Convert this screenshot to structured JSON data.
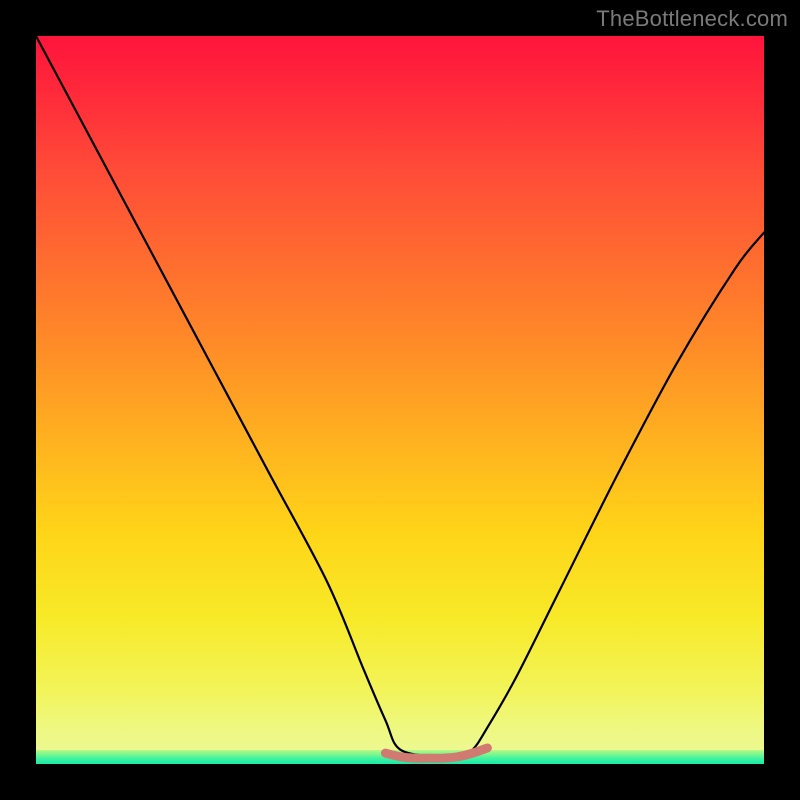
{
  "watermark": "TheBottleneck.com",
  "chart_data": {
    "type": "line",
    "title": "",
    "xlabel": "",
    "ylabel": "",
    "xlim": [
      0,
      100
    ],
    "ylim": [
      0,
      100
    ],
    "grid": false,
    "series": [
      {
        "name": "bottleneck-curve",
        "x": [
          0,
          8,
          16,
          24,
          32,
          40,
          45,
          48,
          50,
          55,
          58,
          60,
          62,
          66,
          72,
          80,
          88,
          96,
          100
        ],
        "values": [
          100,
          85,
          70,
          55,
          40,
          25,
          13,
          6,
          2,
          1,
          1,
          2,
          5,
          12,
          24,
          40,
          55,
          68,
          73
        ]
      },
      {
        "name": "trough-marker",
        "x": [
          48,
          50,
          52,
          54,
          56,
          58,
          60,
          62
        ],
        "values": [
          1.5,
          1.0,
          0.8,
          0.8,
          0.8,
          1.0,
          1.5,
          2.2
        ]
      }
    ],
    "colors": {
      "curve": "#000000",
      "trough_marker": "#d17a72",
      "gradient_top": "#ff143c",
      "gradient_bottom": "#ecf99a",
      "green_band": "#3ff3a0"
    }
  }
}
